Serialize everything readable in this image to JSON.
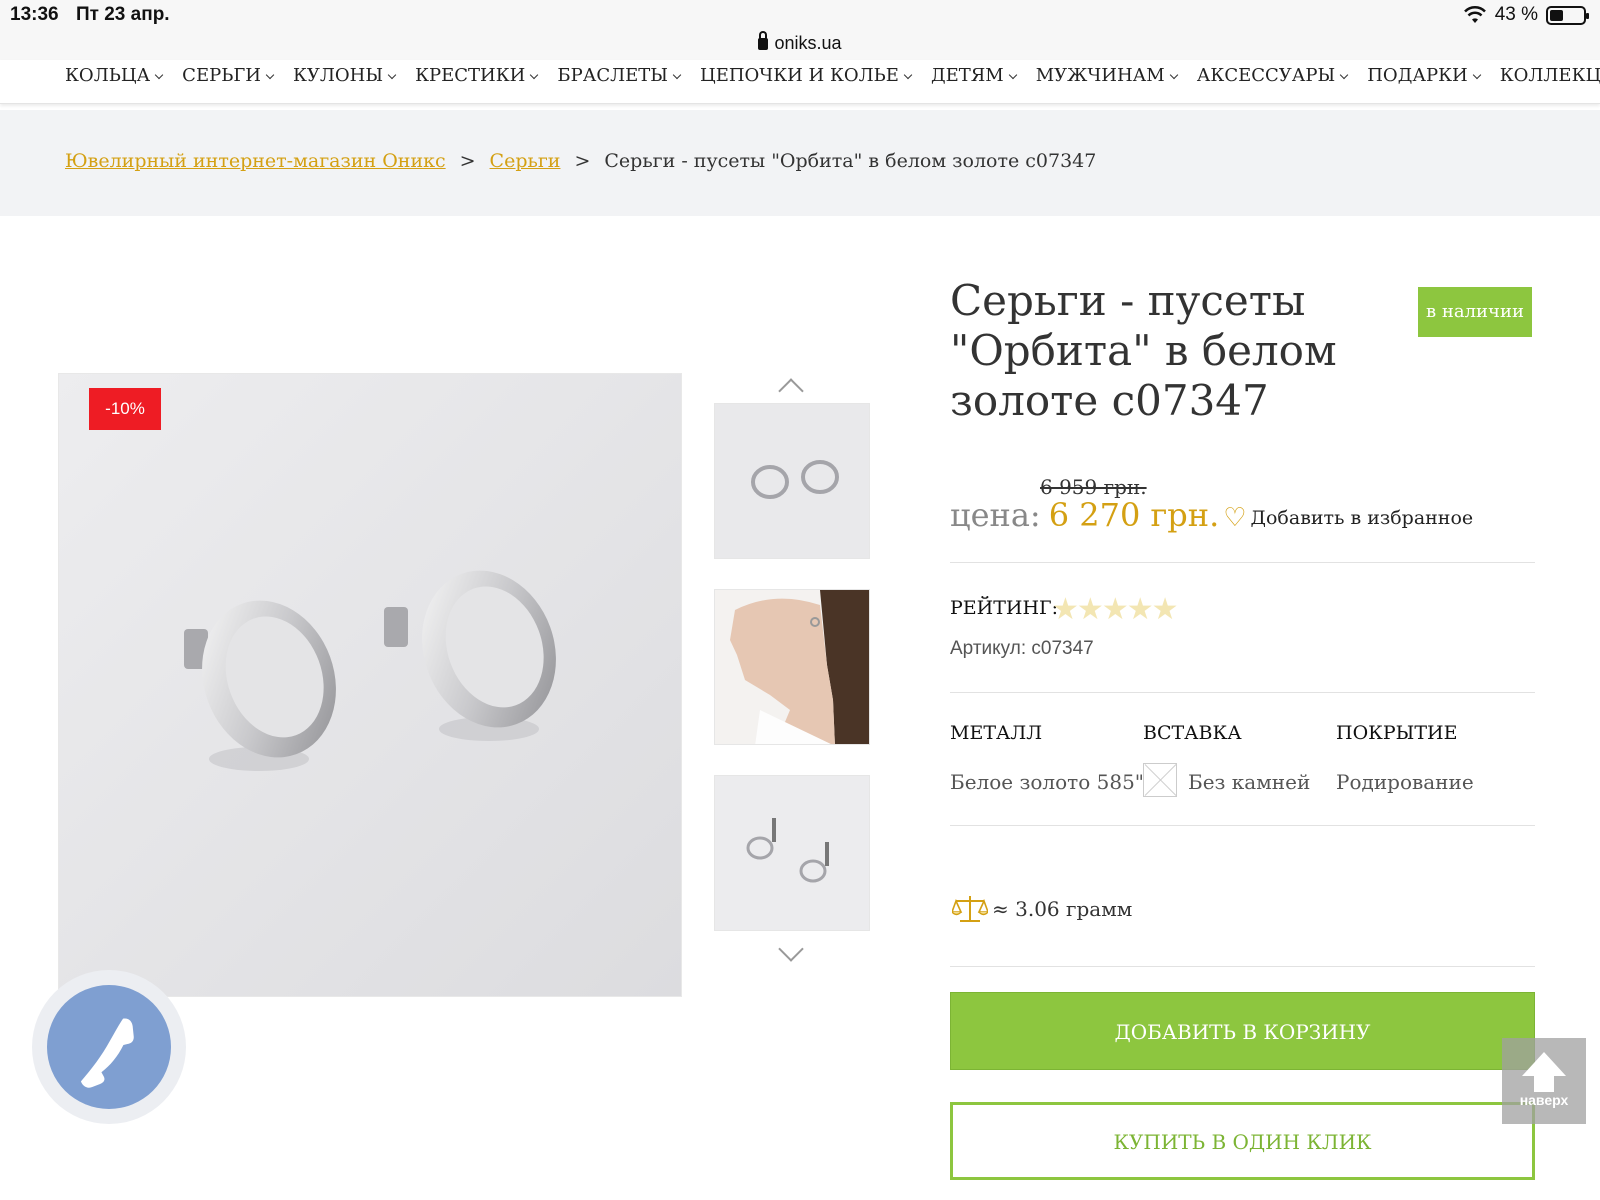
{
  "status_bar": {
    "time": "13:36",
    "date": "Пт 23 апр.",
    "battery": "43 %"
  },
  "url": "oniks.ua",
  "menu": [
    "КОЛЬЦА",
    "СЕРЬГИ",
    "КУЛОНЫ",
    "КРЕСТИКИ",
    "БРАСЛЕТЫ",
    "ЦЕПОЧКИ И КОЛЬЕ",
    "ДЕТЯМ",
    "МУЖЧИНАМ",
    "АКСЕССУАРЫ",
    "ПОДАРКИ",
    "КОЛЛЕКЦИИ"
  ],
  "breadcrumb": {
    "home": "Ювелирный интернет-магазин Оникс",
    "sep": ">",
    "category": "Серьги",
    "current": "Серьги - пусеты \"Орбита\" в белом золоте с07347"
  },
  "gallery": {
    "discount": "-10%"
  },
  "product": {
    "title": "Серьги - пусеты \"Орбита\" в белом золоте с07347",
    "stock": "в наличии",
    "old_price": "6 959 грн.",
    "price_label": "цена:",
    "price": "6 270 грн.",
    "favorite": "Добавить в избранное",
    "rating_label": "РЕЙТИНГ:",
    "rating_value": 0,
    "article": "Артикул: с07347",
    "props": [
      {
        "head": "МЕТАЛЛ",
        "value": "Белое золото 585\""
      },
      {
        "head": "ВСТАВКА",
        "value": "Без камней"
      },
      {
        "head": "ПОКРЫТИЕ",
        "value": "Родирование"
      }
    ],
    "weight": "≈ 3.06 грамм",
    "add_to_cart": "ДОБАВИТЬ В КОРЗИНУ",
    "one_click": "КУПИТЬ В ОДИН КЛИК"
  },
  "to_top": "наверх",
  "colors": {
    "accent_gold": "#d4a013",
    "green": "#8dc63f",
    "sale_red": "#ee1c24",
    "call_blue": "#7f9fd1"
  },
  "icons": [
    "lock-icon",
    "wifi-icon",
    "battery-icon",
    "heart-icon",
    "star-icon",
    "scales-icon",
    "phone-icon",
    "arrow-up-icon",
    "chevron-down-icon"
  ]
}
